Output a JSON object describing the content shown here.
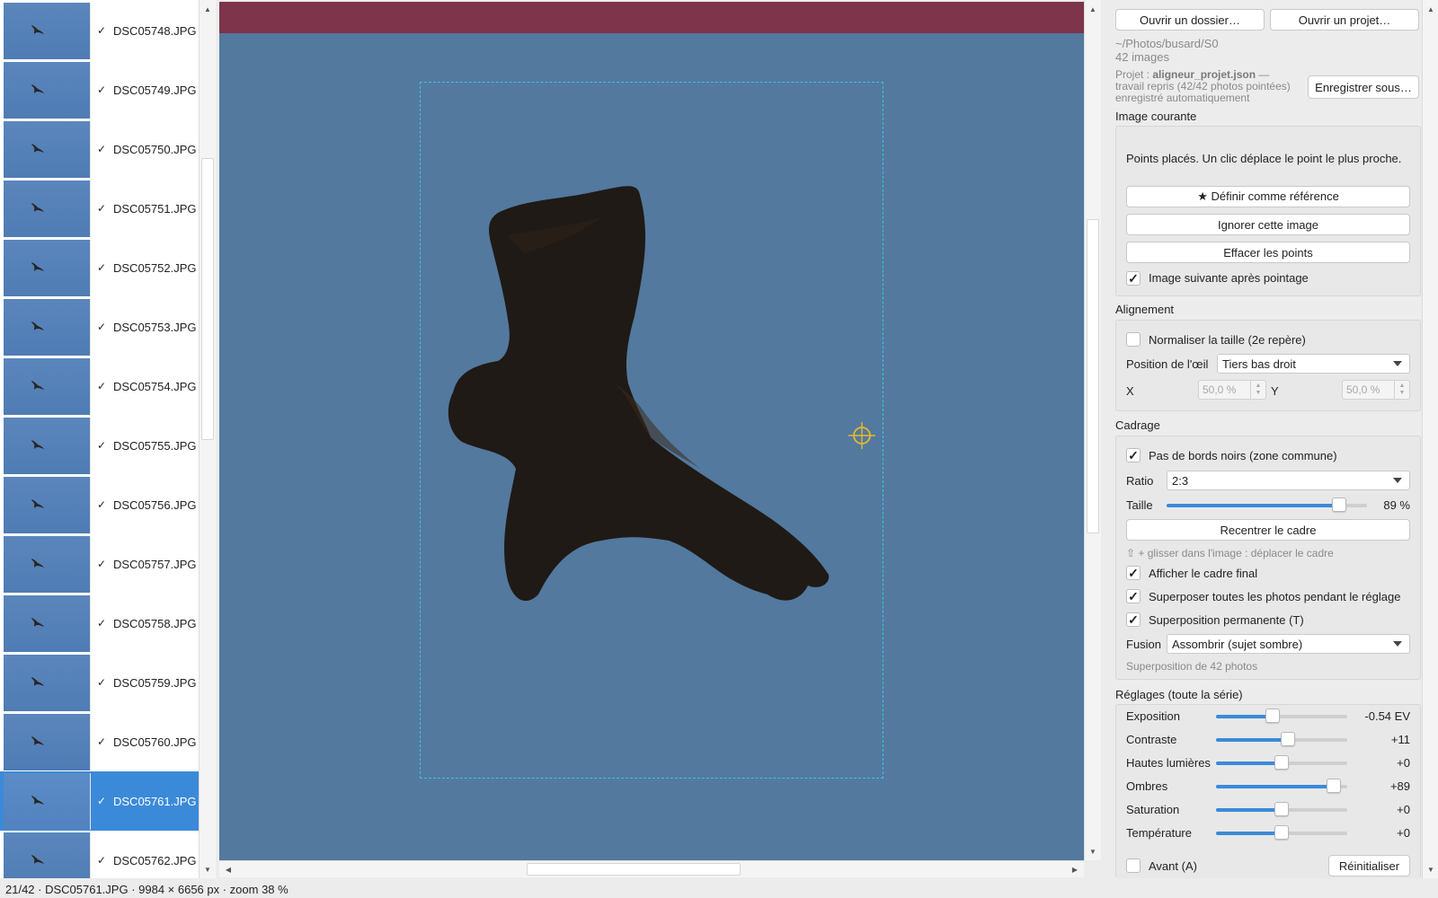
{
  "thumbnails": [
    {
      "name": "DSC05748.JPG",
      "checked": true
    },
    {
      "name": "DSC05749.JPG",
      "checked": true
    },
    {
      "name": "DSC05750.JPG",
      "checked": true
    },
    {
      "name": "DSC05751.JPG",
      "checked": true
    },
    {
      "name": "DSC05752.JPG",
      "checked": true
    },
    {
      "name": "DSC05753.JPG",
      "checked": true
    },
    {
      "name": "DSC05754.JPG",
      "checked": true
    },
    {
      "name": "DSC05755.JPG",
      "checked": true
    },
    {
      "name": "DSC05756.JPG",
      "checked": true
    },
    {
      "name": "DSC05757.JPG",
      "checked": true
    },
    {
      "name": "DSC05758.JPG",
      "checked": true
    },
    {
      "name": "DSC05759.JPG",
      "checked": true
    },
    {
      "name": "DSC05760.JPG",
      "checked": true
    },
    {
      "name": "DSC05761.JPG",
      "checked": true,
      "selected": true
    },
    {
      "name": "DSC05762.JPG",
      "checked": true
    }
  ],
  "check_glyph": "✓",
  "panel": {
    "open_folder": "Ouvrir un dossier…",
    "open_project": "Ouvrir un projet…",
    "path": "~/Photos/busard/S0",
    "image_count": "42 images",
    "project_prefix": "Projet : ",
    "project_name": "aligneur_projet.json",
    "project_suffix": " —",
    "project_line2": "travail repris (42/42 photos pointées)",
    "project_line3": "enregistré automatiquement",
    "save_as": "Enregistrer sous…",
    "current_image": {
      "title": "Image courante",
      "info": "Points placés. Un clic déplace le point le plus proche.",
      "set_reference": "★ Définir comme référence",
      "ignore": "Ignorer cette image",
      "clear_points": "Effacer les points",
      "next_after": "Image suivante après pointage",
      "next_after_checked": true
    },
    "alignment": {
      "title": "Alignement",
      "normalize": "Normaliser la taille (2e repère)",
      "normalize_checked": false,
      "eye_position_label": "Position de l'œil",
      "eye_position_value": "Tiers bas droit",
      "x_label": "X",
      "x_value": "50,0 %",
      "y_label": "Y",
      "y_value": "50,0 %"
    },
    "framing": {
      "title": "Cadrage",
      "no_black_borders": "Pas de bords noirs (zone commune)",
      "no_black_borders_checked": true,
      "ratio_label": "Ratio",
      "ratio_value": "2:3",
      "size_label": "Taille",
      "size_value": "89 %",
      "size_fraction": 0.89,
      "recenter": "Recentrer le cadre",
      "drag_hint": "⇧ + glisser dans l'image : déplacer le cadre",
      "show_final": "Afficher le cadre final",
      "show_final_checked": true,
      "overlay_all": "Superposer toutes les photos pendant le réglage",
      "overlay_all_checked": true,
      "overlay_permanent": "Superposition permanente (T)",
      "overlay_permanent_checked": true,
      "blend_label": "Fusion",
      "blend_value": "Assombrir (sujet sombre)",
      "overlay_note": "Superposition de 42 photos"
    },
    "adjustments": {
      "title": "Réglages (toute la série)",
      "items": [
        {
          "label": "Exposition",
          "value": "-0.54 EV",
          "fraction": 0.42
        },
        {
          "label": "Contraste",
          "value": "+11",
          "fraction": 0.555
        },
        {
          "label": "Hautes lumières",
          "value": "+0",
          "fraction": 0.5
        },
        {
          "label": "Ombres",
          "value": "+89",
          "fraction": 0.945
        },
        {
          "label": "Saturation",
          "value": "+0",
          "fraction": 0.5
        },
        {
          "label": "Température",
          "value": "+0",
          "fraction": 0.5
        }
      ],
      "before": "Avant (A)",
      "before_checked": false,
      "reset": "Réinitialiser"
    }
  },
  "status": {
    "text": "21/42  ·  DSC05761.JPG  ·  9984 × 6656 px  ·  zoom 38 %"
  },
  "colors": {
    "accent": "#3b8ad9",
    "sky": "#53799e",
    "top_band": "#7e344b",
    "crop_frame": "#3fc1e8",
    "marker": "#e7b82c"
  }
}
